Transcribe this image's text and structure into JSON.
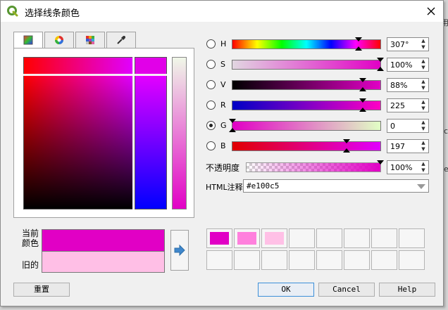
{
  "dialog": {
    "title": "选择线条颜色"
  },
  "tabs": [
    {
      "name": "color-wheel-tab",
      "icon": "gradient-square-icon"
    },
    {
      "name": "color-ring-tab",
      "icon": "color-wheel-icon"
    },
    {
      "name": "swatch-grid-tab",
      "icon": "palette-grid-icon"
    },
    {
      "name": "eyedropper-tab",
      "icon": "eyedropper-icon"
    }
  ],
  "channels": [
    {
      "key": "H",
      "label": "H",
      "value": "307°",
      "fraction": 0.85,
      "checked": false,
      "gradient": "linear-gradient(to right,#ff0000,#ffff00,#00ff00,#00ffff,#0000ff,#ff00ff,#ff0000)"
    },
    {
      "key": "S",
      "label": "S",
      "value": "100%",
      "fraction": 1.0,
      "checked": false,
      "gradient": "linear-gradient(to right,#e1d6e1,#e100c5)"
    },
    {
      "key": "V",
      "label": "V",
      "value": "88%",
      "fraction": 0.88,
      "checked": false,
      "gradient": "linear-gradient(to right,#000000,#e100c5)"
    },
    {
      "key": "R",
      "label": "R",
      "value": "225",
      "fraction": 0.88,
      "checked": false,
      "gradient": "linear-gradient(to right,#0000c5,#ff00c5)"
    },
    {
      "key": "G",
      "label": "G",
      "value": "0",
      "fraction": 0.0,
      "checked": true,
      "gradient": "linear-gradient(to right,#e100c5,#e1ffc5)"
    },
    {
      "key": "B",
      "label": "B",
      "value": "197",
      "fraction": 0.77,
      "checked": false,
      "gradient": "linear-gradient(to right,#e10000,#e100ff)"
    }
  ],
  "opacity": {
    "label": "不透明度",
    "value": "100%",
    "fraction": 1.0
  },
  "html": {
    "label": "HTML注释",
    "value": "#e100c5"
  },
  "preview": {
    "current_label": "当前\n颜色",
    "old_label": "旧的",
    "current_color": "#e100c5",
    "old_color": "#ffbfe6"
  },
  "swatches": {
    "row1": [
      "#e100c5",
      "#ff80dd",
      "#ffc0e6",
      "",
      "",
      "",
      "",
      ""
    ],
    "row2": [
      "",
      "",
      "",
      "",
      "",
      "",
      "",
      ""
    ]
  },
  "buttons": {
    "reset": "重置",
    "ok": "OK",
    "cancel": "Cancel",
    "help": "Help"
  },
  "background": {
    "text1": "用",
    "text2": "ca",
    "text3": "ext"
  }
}
